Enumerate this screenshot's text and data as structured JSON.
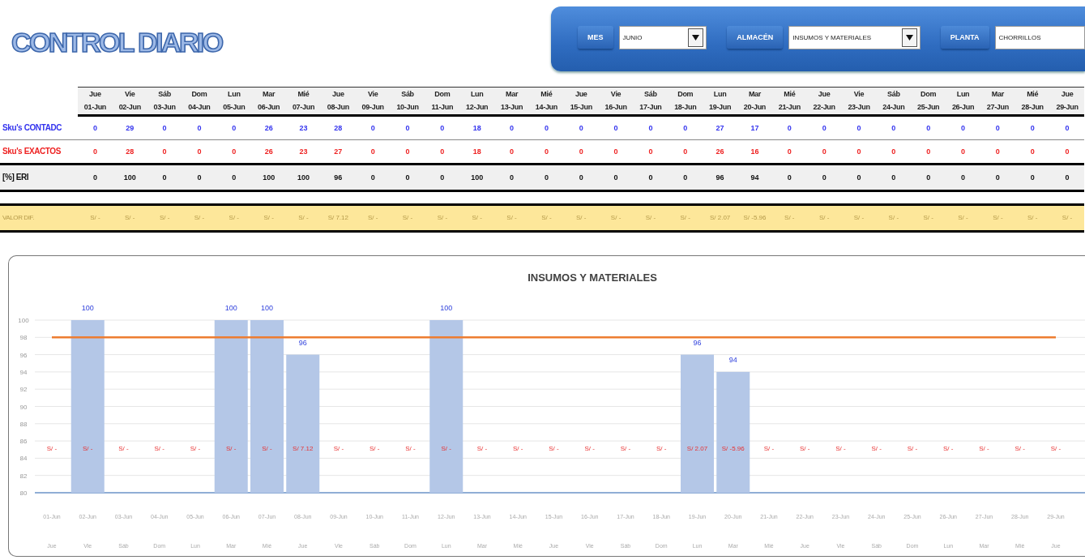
{
  "title": "CONTROL DIARIO",
  "filters": [
    {
      "label": "MES",
      "value": "JUNIO",
      "dropdown": true
    },
    {
      "label": "ALMACÉN",
      "value": "INSUMOS Y MATERIALES",
      "dropdown": true
    },
    {
      "label": "PLANTA",
      "value": "CHORRILLOS",
      "dropdown": false
    }
  ],
  "table": {
    "days": [
      "Jue",
      "Vie",
      "Sáb",
      "Dom",
      "Lun",
      "Mar",
      "Mié",
      "Jue",
      "Vie",
      "Sáb",
      "Dom",
      "Lun",
      "Mar",
      "Mié",
      "Jue",
      "Vie",
      "Sáb",
      "Dom",
      "Lun",
      "Mar",
      "Mié",
      "Jue",
      "Vie",
      "Sáb",
      "Dom",
      "Lun",
      "Mar",
      "Mié",
      "Jue"
    ],
    "dates": [
      "01-Jun",
      "02-Jun",
      "03-Jun",
      "04-Jun",
      "05-Jun",
      "06-Jun",
      "07-Jun",
      "08-Jun",
      "09-Jun",
      "10-Jun",
      "11-Jun",
      "12-Jun",
      "13-Jun",
      "14-Jun",
      "15-Jun",
      "16-Jun",
      "17-Jun",
      "18-Jun",
      "19-Jun",
      "20-Jun",
      "21-Jun",
      "22-Jun",
      "23-Jun",
      "24-Jun",
      "25-Jun",
      "26-Jun",
      "27-Jun",
      "28-Jun",
      "29-Jun"
    ],
    "rows": [
      {
        "kind": "count",
        "label": "Sku's CONTADC",
        "cells": [
          "0",
          "29",
          "0",
          "0",
          "0",
          "26",
          "23",
          "28",
          "0",
          "0",
          "0",
          "18",
          "0",
          "0",
          "0",
          "0",
          "0",
          "0",
          "27",
          "17",
          "0",
          "0",
          "0",
          "0",
          "0",
          "0",
          "0",
          "0",
          "0"
        ]
      },
      {
        "kind": "exact",
        "label": "Sku's EXACTOS",
        "cells": [
          "0",
          "28",
          "0",
          "0",
          "0",
          "26",
          "23",
          "27",
          "0",
          "0",
          "0",
          "18",
          "0",
          "0",
          "0",
          "0",
          "0",
          "0",
          "26",
          "16",
          "0",
          "0",
          "0",
          "0",
          "0",
          "0",
          "0",
          "0",
          "0"
        ]
      },
      {
        "kind": "percent",
        "label": "[%] ERI",
        "cells": [
          "0",
          "100",
          "0",
          "0",
          "0",
          "100",
          "100",
          "96",
          "0",
          "0",
          "0",
          "100",
          "0",
          "0",
          "0",
          "0",
          "0",
          "0",
          "96",
          "94",
          "0",
          "0",
          "0",
          "0",
          "0",
          "0",
          "0",
          "0",
          "0"
        ]
      },
      {
        "kind": "value",
        "label": "VALOR DIF.",
        "cells": [
          "S/ -",
          "S/ -",
          "S/ -",
          "S/ -",
          "S/ -",
          "S/ -",
          "S/ -",
          "S/ 7.12",
          "S/ -",
          "S/ -",
          "S/ -",
          "S/ -",
          "S/ -",
          "S/ -",
          "S/ -",
          "S/ -",
          "S/ -",
          "S/ -",
          "S/ 2.07",
          "S/ -5.96",
          "S/ -",
          "S/ -",
          "S/ -",
          "S/ -",
          "S/ -",
          "S/ -",
          "S/ -",
          "S/ -",
          "S/ -"
        ]
      }
    ]
  },
  "chart": {
    "day_labels": [
      "Jue",
      "Vie",
      "Sáb",
      "Dom",
      "Lun",
      "Mar",
      "Mié",
      "Jue",
      "Vie",
      "Sáb",
      "Dom",
      "Lun",
      "Mar",
      "Mié",
      "Jue",
      "Vie",
      "Sáb",
      "Dom",
      "Lun",
      "Mar",
      "Mié",
      "Jue",
      "Vie",
      "Sáb",
      "Dom",
      "Lun",
      "Mar",
      "Mié",
      "Jue"
    ],
    "amount_labels": [
      "S/ -",
      "S/ -",
      "S/ -",
      "S/ -",
      "S/ -",
      "S/ -",
      "S/ -",
      "S/ 7.12",
      "S/ -",
      "S/ -",
      "S/ -",
      "S/ -",
      "S/ -",
      "S/ -",
      "S/ -",
      "S/ -",
      "S/ -",
      "S/ -",
      "S/ 2.07",
      "S/ -5.96",
      "S/ -",
      "S/ -",
      "S/ -",
      "S/ -",
      "S/ -",
      "S/ -",
      "S/ -",
      "S/ -",
      "S/ -"
    ],
    "chart_data": {
      "type": "bar",
      "title": "INSUMOS Y MATERIALES",
      "categories": [
        "01-Jun",
        "02-Jun",
        "03-Jun",
        "04-Jun",
        "05-Jun",
        "06-Jun",
        "07-Jun",
        "08-Jun",
        "09-Jun",
        "10-Jun",
        "11-Jun",
        "12-Jun",
        "13-Jun",
        "14-Jun",
        "15-Jun",
        "16-Jun",
        "17-Jun",
        "18-Jun",
        "19-Jun",
        "20-Jun",
        "21-Jun",
        "22-Jun",
        "23-Jun",
        "24-Jun",
        "25-Jun",
        "26-Jun",
        "27-Jun",
        "28-Jun",
        "29-Jun"
      ],
      "series": [
        {
          "type": "bar",
          "color": "#b4c7e7",
          "values": [
            null,
            100,
            null,
            null,
            null,
            100,
            100,
            96,
            null,
            null,
            null,
            100,
            null,
            null,
            null,
            null,
            null,
            null,
            96,
            94,
            null,
            null,
            null,
            null,
            null,
            null,
            null,
            null,
            null
          ]
        },
        {
          "type": "line",
          "color": "#ed7d31",
          "values": [
            98,
            98,
            98,
            98,
            98,
            98,
            98,
            98,
            98,
            98,
            98,
            98,
            98,
            98,
            98,
            98,
            98,
            98,
            98,
            98,
            98,
            98,
            98,
            98,
            98,
            98,
            98,
            98,
            98
          ]
        }
      ],
      "ylim": [
        80,
        100
      ],
      "yticks": [
        80,
        82,
        84,
        86,
        88,
        90,
        92,
        94,
        96,
        98,
        100
      ],
      "grid": true,
      "value_labels": [
        null,
        "100",
        null,
        null,
        null,
        "100",
        "100",
        "96",
        null,
        null,
        null,
        "100",
        null,
        null,
        null,
        null,
        null,
        null,
        "96",
        "94",
        null,
        null,
        null,
        null,
        null,
        null,
        null,
        null,
        null
      ]
    }
  }
}
